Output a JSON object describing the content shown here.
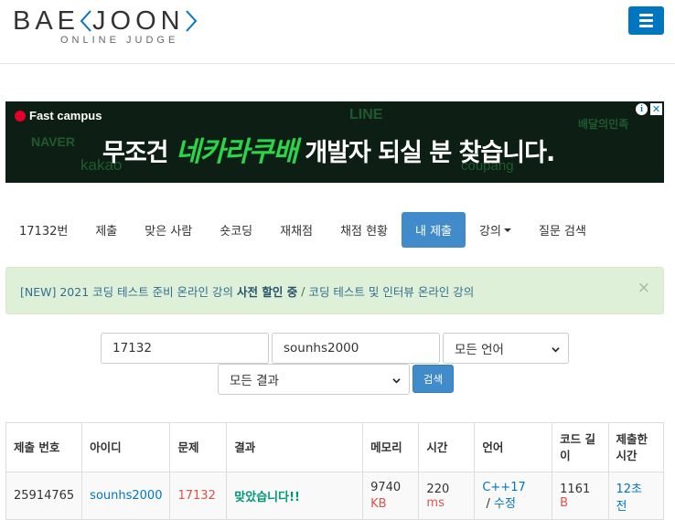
{
  "header": {
    "logo_left": "BAE",
    "logo_right": "JOON",
    "logo_sub": "ONLINE JUDGE"
  },
  "ad": {
    "brand": "Fast campus",
    "logos": [
      "NAVER",
      "kakao",
      "LINE",
      "coupang",
      "배달의민족"
    ],
    "headline_pre": "무조건",
    "headline_hl": "네카라쿠배",
    "headline_post": "개발자 되실 분 찾습니다.",
    "info": "i",
    "close": "✕",
    "colors": {
      "background": "#0d1f15",
      "highlight": "#2bd44a",
      "brand_dot": "#e4002b"
    }
  },
  "tabs": [
    {
      "label": "17132번",
      "active": false
    },
    {
      "label": "제출",
      "active": false
    },
    {
      "label": "맞은 사람",
      "active": false
    },
    {
      "label": "숏코딩",
      "active": false
    },
    {
      "label": "재채점",
      "active": false
    },
    {
      "label": "채점 현황",
      "active": false
    },
    {
      "label": "내 제출",
      "active": true
    },
    {
      "label": "강의",
      "active": false,
      "dropdown": true
    },
    {
      "label": "질문 검색",
      "active": false
    }
  ],
  "notice": {
    "part1": "[NEW] 2021 코딩 테스트 준비 온라인 강의 ",
    "part2": "사전 할인 중",
    "separator": "/",
    "part3": "코딩 테스트 및 인터뷰 온라인 강의",
    "close": "×"
  },
  "filters": {
    "problem_value": "17132",
    "user_value": "sounhs2000",
    "language_selected": "모든 언어",
    "result_selected": "모든 결과",
    "search_label": "검색"
  },
  "table": {
    "headers": [
      "제출 번호",
      "아이디",
      "문제",
      "결과",
      "메모리",
      "시간",
      "언어",
      "코드 길이",
      "제출한 시간"
    ],
    "rows": [
      {
        "submission_id": "25914765",
        "user": "sounhs2000",
        "problem": "17132",
        "result": "맞았습니다!!",
        "memory": "9740",
        "memory_unit": "KB",
        "time": "220",
        "time_unit": "ms",
        "language": "C++17",
        "language_sep": " / ",
        "edit": "수정",
        "code_length": "1161",
        "code_unit": "B",
        "submitted": "12초 전"
      }
    ]
  },
  "colors": {
    "primary": "#0076c0",
    "tab_active": "#428bca",
    "accepted": "#009874",
    "notice_bg": "#dff0d8"
  }
}
